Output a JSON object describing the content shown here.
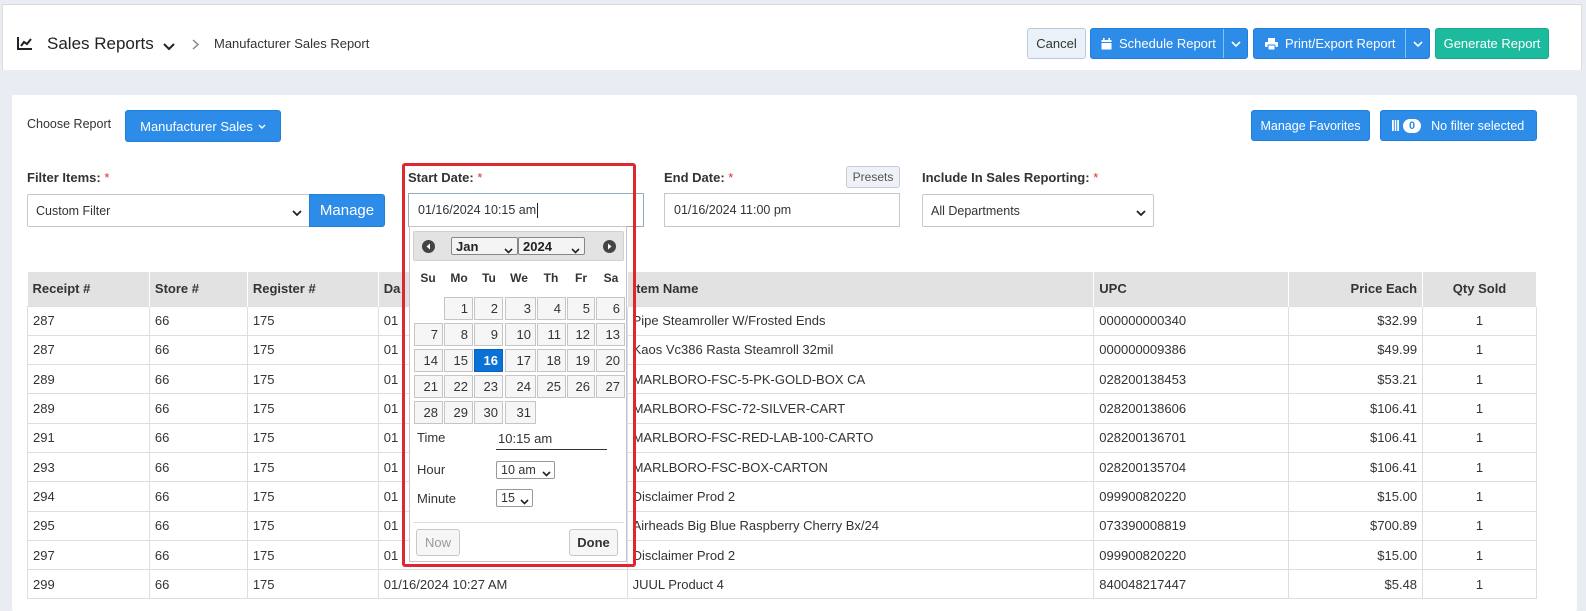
{
  "header": {
    "section_title": "Sales Reports",
    "breadcrumb_current": "Manufacturer Sales Report",
    "cancel_label": "Cancel",
    "schedule_label": "Schedule Report",
    "print_label": "Print/Export Report",
    "generate_label": "Generate Report"
  },
  "report": {
    "choose_label": "Choose Report",
    "choose_value": "Manufacturer Sales",
    "manage_favorites_label": "Manage Favorites",
    "filter_count": "0",
    "filter_status": "No filter selected"
  },
  "filters": {
    "filter_items_label": "Filter Items:",
    "filter_items_value": "Custom Filter",
    "manage_label": "Manage",
    "start_date_label": "Start Date:",
    "start_date_value": "01/16/2024 10:15 am",
    "end_date_label": "End Date:",
    "end_date_value": "01/16/2024 11:00 pm",
    "presets_label": "Presets",
    "include_label": "Include In Sales Reporting:",
    "include_value": "All Departments",
    "required_mark": "*"
  },
  "datepicker": {
    "month": "Jan",
    "year": "2024",
    "weekdays": [
      "Su",
      "Mo",
      "Tu",
      "We",
      "Th",
      "Fr",
      "Sa"
    ],
    "days": [
      "1",
      "2",
      "3",
      "4",
      "5",
      "6",
      "7",
      "8",
      "9",
      "10",
      "11",
      "12",
      "13",
      "14",
      "15",
      "16",
      "17",
      "18",
      "19",
      "20",
      "21",
      "22",
      "23",
      "24",
      "25",
      "26",
      "27",
      "28",
      "29",
      "30",
      "31"
    ],
    "selected_day": "16",
    "time_label": "Time",
    "time_value": "10:15 am",
    "hour_label": "Hour",
    "hour_value": "10 am",
    "minute_label": "Minute",
    "minute_value": "15",
    "now_label": "Now",
    "done_label": "Done"
  },
  "table": {
    "columns": [
      "Receipt #",
      "Store #",
      "Register #",
      "Da",
      "Item Name",
      "UPC",
      "Price Each",
      "Qty Sold"
    ],
    "rows": [
      {
        "receipt": "287",
        "store": "66",
        "register": "175",
        "date": "01",
        "item": "Pipe Steamroller W/Frosted Ends",
        "upc": "000000000340",
        "price": "$32.99",
        "qty": "1"
      },
      {
        "receipt": "287",
        "store": "66",
        "register": "175",
        "date": "01",
        "item": "Kaos Vc386 Rasta Steamroll 32mil",
        "upc": "000000009386",
        "price": "$49.99",
        "qty": "1"
      },
      {
        "receipt": "289",
        "store": "66",
        "register": "175",
        "date": "01",
        "item": "MARLBORO-FSC-5-PK-GOLD-BOX CA",
        "upc": "028200138453",
        "price": "$53.21",
        "qty": "1"
      },
      {
        "receipt": "289",
        "store": "66",
        "register": "175",
        "date": "01",
        "item": "MARLBORO-FSC-72-SILVER-CART",
        "upc": "028200138606",
        "price": "$106.41",
        "qty": "1"
      },
      {
        "receipt": "291",
        "store": "66",
        "register": "175",
        "date": "01",
        "item": "MARLBORO-FSC-RED-LAB-100-CARTO",
        "upc": "028200136701",
        "price": "$106.41",
        "qty": "1"
      },
      {
        "receipt": "293",
        "store": "66",
        "register": "175",
        "date": "01",
        "item": "MARLBORO-FSC-BOX-CARTON",
        "upc": "028200135704",
        "price": "$106.41",
        "qty": "1"
      },
      {
        "receipt": "294",
        "store": "66",
        "register": "175",
        "date": "01",
        "item": "Disclaimer Prod 2",
        "upc": "099900820220",
        "price": "$15.00",
        "qty": "1"
      },
      {
        "receipt": "295",
        "store": "66",
        "register": "175",
        "date": "01",
        "item": "Airheads Big Blue Raspberry Cherry Bx/24",
        "upc": "073390008819",
        "price": "$700.89",
        "qty": "1"
      },
      {
        "receipt": "297",
        "store": "66",
        "register": "175",
        "date": "01",
        "item": "Disclaimer Prod 2",
        "upc": "099900820220",
        "price": "$15.00",
        "qty": "1"
      },
      {
        "receipt": "299",
        "store": "66",
        "register": "175",
        "date": "01/16/2024 10:27 AM",
        "item": "JUUL Product 4",
        "upc": "840048217447",
        "price": "$5.48",
        "qty": "1"
      }
    ]
  },
  "colors": {
    "primary": "#2d8ce8",
    "generate": "#1dbb9e",
    "highlight_border": "#e0262f",
    "selected_day": "#0a72d6"
  },
  "icons": [
    "chart-line-icon",
    "chevron-down-icon",
    "chevron-right-icon",
    "calendar-icon",
    "printer-icon",
    "filter-icon",
    "circle-left-icon",
    "circle-right-icon"
  ]
}
